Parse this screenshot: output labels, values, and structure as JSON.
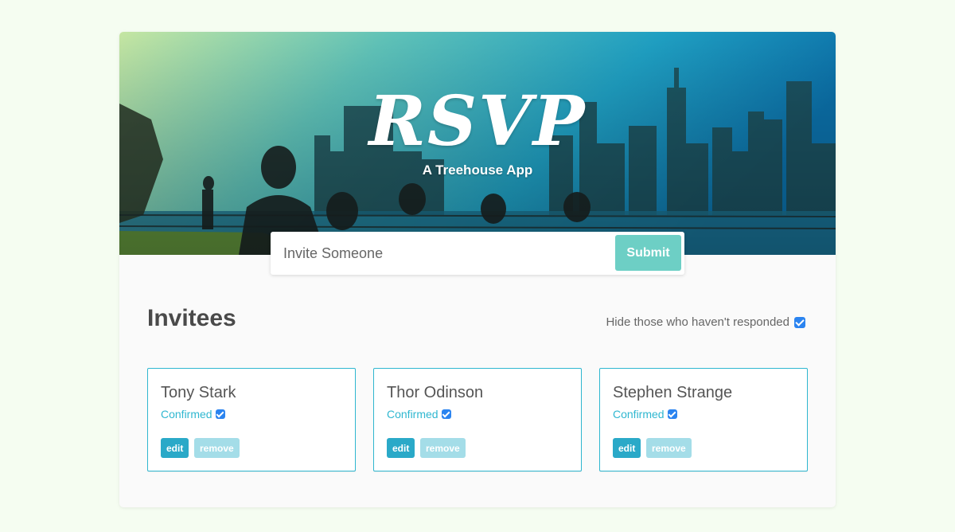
{
  "header": {
    "logo": "RSVP",
    "tagline": "A Treehouse App"
  },
  "invite_form": {
    "placeholder": "Invite Someone",
    "submit_label": "Submit"
  },
  "main": {
    "title": "Invitees",
    "filter_label": "Hide those who haven't responded",
    "filter_checked": true
  },
  "invitees": [
    {
      "name": "Tony Stark",
      "status": "Confirmed",
      "confirmed": true,
      "edit_label": "edit",
      "remove_label": "remove"
    },
    {
      "name": "Thor Odinson",
      "status": "Confirmed",
      "confirmed": true,
      "edit_label": "edit",
      "remove_label": "remove"
    },
    {
      "name": "Stephen Strange",
      "status": "Confirmed",
      "confirmed": true,
      "edit_label": "edit",
      "remove_label": "remove"
    }
  ],
  "colors": {
    "page_bg": "#f5fdf1",
    "accent": "#2fb7d0",
    "submit_bg": "#6dcfc5",
    "checkbox": "#2b84f0"
  }
}
